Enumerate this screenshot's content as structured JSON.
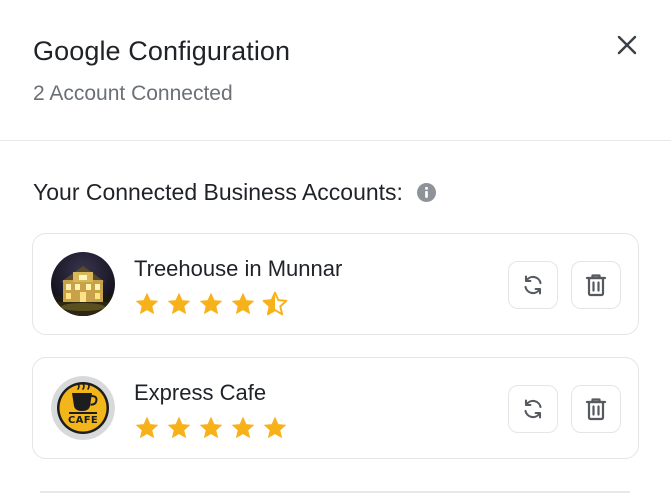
{
  "header": {
    "title": "Google Configuration",
    "subtitle": "2 Account Connected"
  },
  "section": {
    "title": "Your Connected Business Accounts:"
  },
  "accounts": [
    {
      "name": "Treehouse in Munnar",
      "rating": 4.5,
      "avatar": "hotel-photo"
    },
    {
      "name": "Express Cafe",
      "rating": 5,
      "avatar": "cafe-logo",
      "logo_text": "CAFE"
    }
  ],
  "colors": {
    "star": "#f7b21b",
    "icon": "#555a60",
    "border": "#e3e5e8",
    "info": "#8e939a"
  },
  "icons": {
    "close": "close-icon",
    "info": "info-icon",
    "refresh": "refresh-icon",
    "delete": "trash-icon"
  }
}
